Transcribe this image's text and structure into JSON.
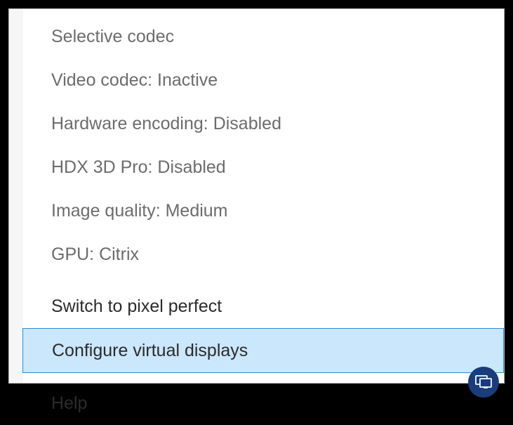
{
  "menu": {
    "status": [
      {
        "label": "Selective codec"
      },
      {
        "label": "Video codec: Inactive"
      },
      {
        "label": "Hardware encoding: Disabled"
      },
      {
        "label": "HDX 3D Pro: Disabled"
      },
      {
        "label": "Image quality: Medium"
      },
      {
        "label": "GPU: Citrix"
      }
    ],
    "actions": [
      {
        "label": "Switch to pixel perfect",
        "highlighted": false
      },
      {
        "label": "Configure virtual displays",
        "highlighted": true
      }
    ],
    "help": {
      "label": "Help"
    }
  },
  "tray": {
    "icon": "citrix-hdx-icon"
  }
}
